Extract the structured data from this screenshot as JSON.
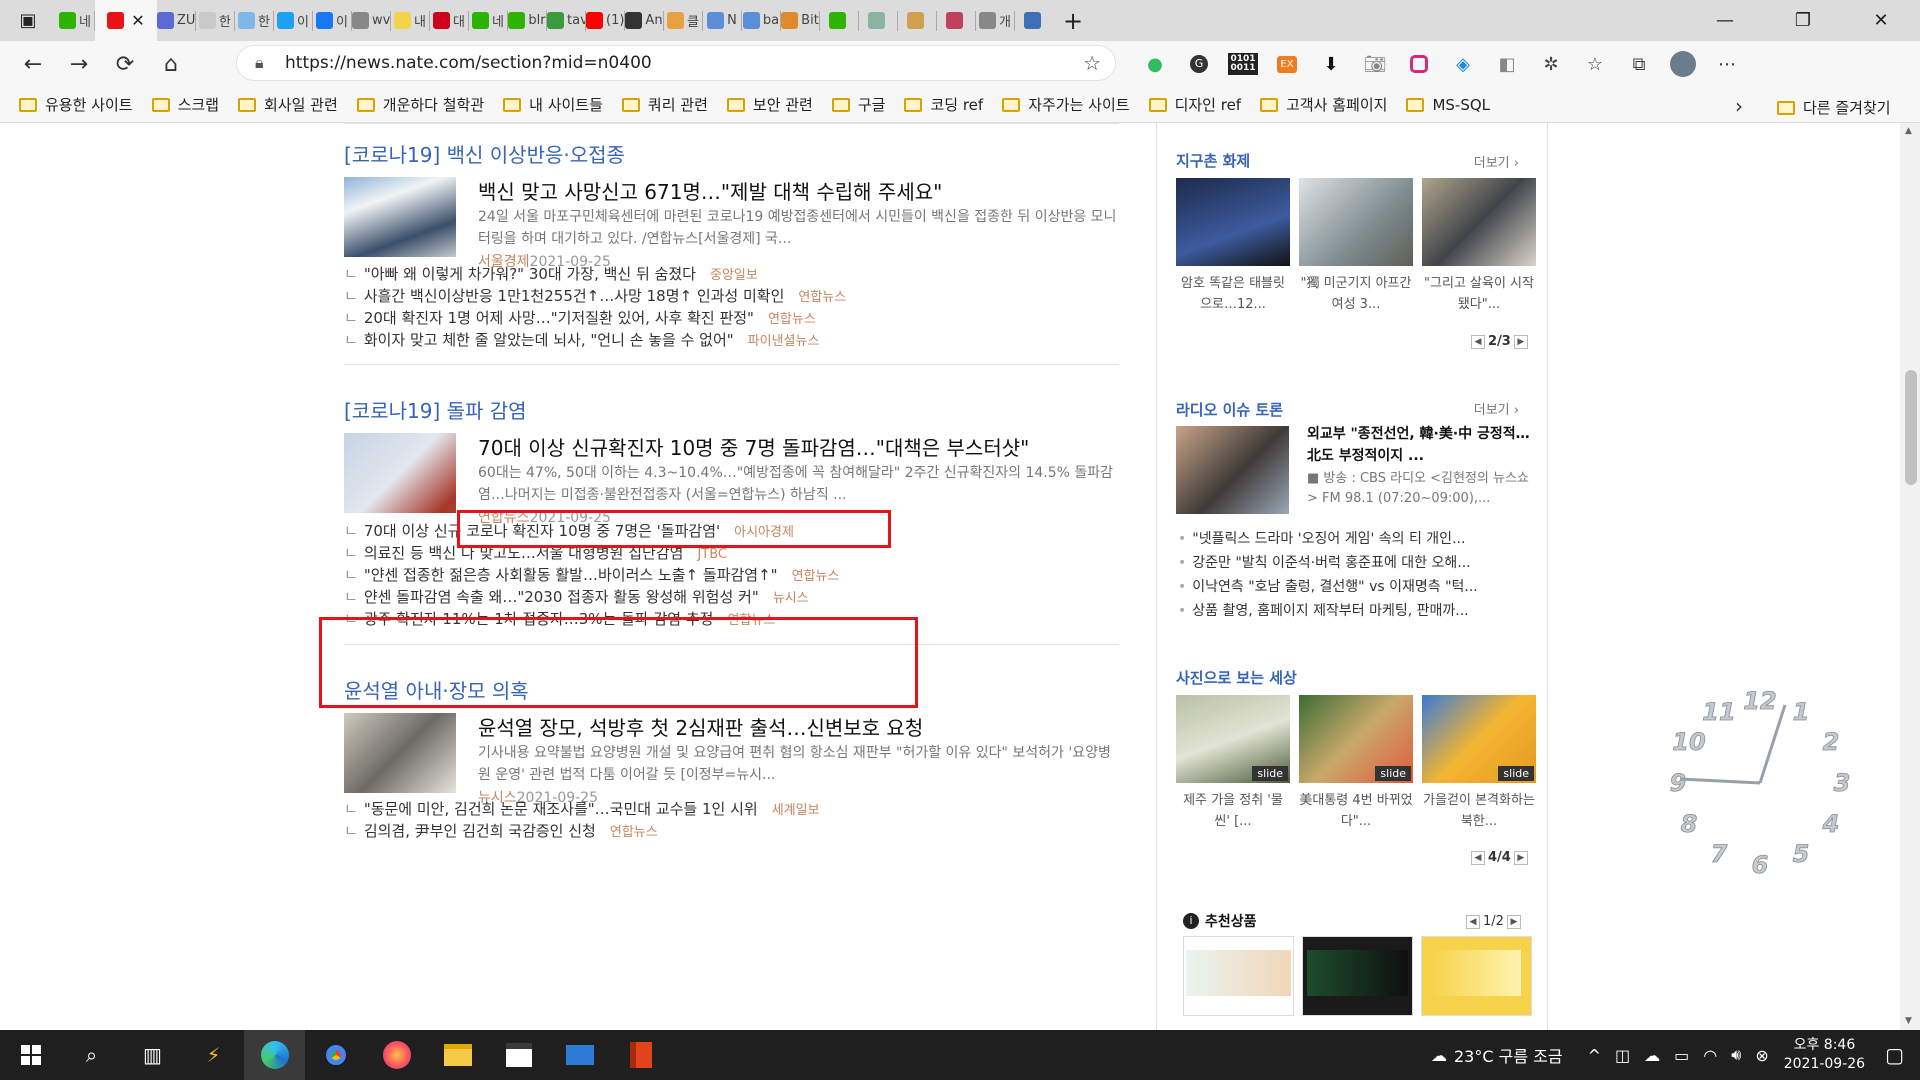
{
  "browser": {
    "url": "https://news.nate.com/section?mid=n0400",
    "tabs": [
      {
        "label": "네",
        "color": "#2db400"
      },
      {
        "label": "",
        "color": "#e8121a",
        "active": true
      },
      {
        "label": "ZU",
        "color": "#5a6bd6"
      },
      {
        "label": "한",
        "color": "#c9c9c9"
      },
      {
        "label": "한",
        "color": "#7fb7e8"
      },
      {
        "label": "이",
        "color": "#1da1f2"
      },
      {
        "label": "이",
        "color": "#1877f2"
      },
      {
        "label": "wv",
        "color": "#888888"
      },
      {
        "label": "내",
        "color": "#f3d34a"
      },
      {
        "label": "대",
        "color": "#d0021b"
      },
      {
        "label": "네",
        "color": "#2db400"
      },
      {
        "label": "blr",
        "color": "#2db400"
      },
      {
        "label": "tav",
        "color": "#3a9b3a"
      },
      {
        "label": "(1)",
        "color": "#ff0000"
      },
      {
        "label": "An",
        "color": "#333333"
      },
      {
        "label": "클",
        "color": "#e8a040"
      },
      {
        "label": "N",
        "color": "#5a8fd8"
      },
      {
        "label": "ba",
        "color": "#5a8fd8"
      },
      {
        "label": "Bit",
        "color": "#e08a2a"
      },
      {
        "label": "",
        "color": "#2db400"
      },
      {
        "label": "",
        "color": "#8ab4a0"
      },
      {
        "label": "",
        "color": "#d0a050"
      },
      {
        "label": "",
        "color": "#c04060"
      },
      {
        "label": "개",
        "color": "#888888"
      },
      {
        "label": "",
        "color": "#3b6fb6"
      }
    ],
    "new_tab": "+",
    "window_controls": {
      "minimize": "—",
      "restore": "❐",
      "close": "✕"
    },
    "nav": {
      "back": "←",
      "forward": "→",
      "refresh": "⟳",
      "home": "⌂"
    },
    "extensions": [
      "evernote-icon",
      "grammarly-icon",
      "binary-icon",
      "ex-icon",
      "pocket-icon",
      "camera-icon",
      "instagram-icon",
      "layers-icon",
      "rss-icon",
      "puzzle-icon",
      "favorites-icon",
      "collections-icon",
      "profile-icon",
      "more-icon"
    ]
  },
  "bookmarks": {
    "items": [
      "유용한 사이트",
      "스크랩",
      "회사일 관련",
      "개운하다 철학관",
      "내 사이트들",
      "쿼리 관련",
      "보안 관련",
      "구글",
      "코딩 ref",
      "자주가는 사이트",
      "디자인 ref",
      "고객사 홈페이지",
      "MS-SQL"
    ],
    "overflow": "›",
    "other": "다른 즐겨찾기"
  },
  "main": {
    "sections": [
      {
        "title": "[코로나19] 백신 이상반응·오접종",
        "headline": "백신 맞고 사망신고 671명…\"제발 대책 수립해 주세요\"",
        "summary": "24일 서울 마포구민체육센터에 마련된 코로나19 예방접종센터에서 시민들이 백신을 접종한 뒤 이상반응 모니터링을 하며 대기하고 있다. /연합뉴스[서울경제] 국...",
        "source": "서울경제",
        "date": "2021-09-25",
        "related": [
          {
            "text": "\"아빠 왜 이렇게 차가워?\" 30대 가장, 백신 뒤 숨졌다",
            "source": "중앙일보"
          },
          {
            "text": "사흘간 백신이상반응 1만1천255건↑…사망 18명↑ 인과성 미확인",
            "source": "연합뉴스"
          },
          {
            "text": "20대 확진자 1명 어제 사망…\"기저질환 있어, 사후 확진 판정\"",
            "source": "연합뉴스"
          },
          {
            "text": "화이자 맞고 체한 줄 알았는데 뇌사, \"언니 손 놓을 수 없어\"",
            "source": "파이낸셜뉴스"
          }
        ]
      },
      {
        "title": "[코로나19] 돌파 감염",
        "headline": "70대 이상 신규확진자 10명 중 7명 돌파감염…\"대책은 부스터샷\"",
        "summary": "60대는 47%, 50대 이하는 4.3~10.4%…\"예방접종에 꼭 참여해달라\" 2주간 신규확진자의 14.5% 돌파감염…나머지는 미접종·불완전접종자 (서울=연합뉴스) 하남직 ...",
        "source": "연합뉴스",
        "date": "2021-09-25",
        "related": [
          {
            "text": "70대 이상 신규 코로나 확진자 10명 중 7명은 '돌파감염'",
            "source": "아시아경제"
          },
          {
            "text": "의료진 등 백신 다 맞고도…서울 대형병원 집단감염",
            "source": "JTBC"
          },
          {
            "text": "\"얀센 접종한 젊은층 사회활동 활발…바이러스 노출↑ 돌파감염↑\"",
            "source": "연합뉴스"
          },
          {
            "text": "얀센 돌파감염 속출 왜…\"2030 접종자 활동 왕성해 위험성 커\"",
            "source": "뉴시스"
          },
          {
            "text": "광주 확진자 11%는 1차 접종자…3%는 돌파 감염 추정",
            "source": "연합뉴스"
          }
        ]
      },
      {
        "title": "윤석열 아내·장모 의혹",
        "headline": "윤석열 장모, 석방후 첫 2심재판 출석…신변보호 요청",
        "summary": "기사내용 요약불법 요양병원 개설 및 요양급여 편취 혐의 항소심 재판부 \"허가할 이유 있다\" 보석허가 '요양병원 운영' 관련 법적 다툼 이어갈 듯 [이정부=뉴시...",
        "source": "뉴시스",
        "date": "2021-09-25",
        "related": [
          {
            "text": "\"동문에 미안, 김건희 논문 재조사를\"…국민대 교수들 1인 시위",
            "source": "세계일보"
          },
          {
            "text": "김의겸, 尹부인 김건희 국감증인 신청",
            "source": "연합뉴스"
          }
        ]
      }
    ]
  },
  "sidebar": {
    "global": {
      "title": "지구촌 화제",
      "more": "더보기",
      "cards": [
        "암호 똑같은 태블릿으로…12...",
        "\"獨 미군기지 아프간 여성 3...",
        "\"그리고 살육이 시작됐다\"..."
      ],
      "page": "2/3"
    },
    "radio": {
      "title": "라디오 이슈 토론",
      "more": "더보기",
      "headline": "외교부 \"종전선언, 韓·美·中 긍정적…北도 부정적이지 ...",
      "sub": "■ 방송 : CBS 라디오 <김현정의 뉴스쇼> FM 98.1 (07:20~09:00),...",
      "bullets": [
        "\"넷플릭스 드라마 '오징어 게임' 속의 티 개인...",
        "강준만 \"발칙 이준석·버럭 홍준표에 대한 오해...",
        "이낙연측 \"호남 출렁, 결선행\" vs 이재명측 \"턱...",
        "상품 촬영, 홈페이지 제작부터 마케팅, 판매까..."
      ]
    },
    "photos": {
      "title": "사진으로 보는 세상",
      "cards": [
        "제주 가을 정취 '물씬' [...",
        "美대통령 4번 바뀌었다\"...",
        "가을걷이 본격화하는 북한..."
      ],
      "slide_label": "slide",
      "page": "4/4"
    },
    "recommend": {
      "title": "추천상품",
      "page": "1/2"
    }
  },
  "clock": {
    "numbers": [
      "12",
      "1",
      "2",
      "3",
      "4",
      "5",
      "6",
      "7",
      "8",
      "9",
      "10",
      "11"
    ]
  },
  "taskbar": {
    "weather": "23°C 구름 조금",
    "time": "오후 8:46",
    "date": "2021-09-26"
  }
}
